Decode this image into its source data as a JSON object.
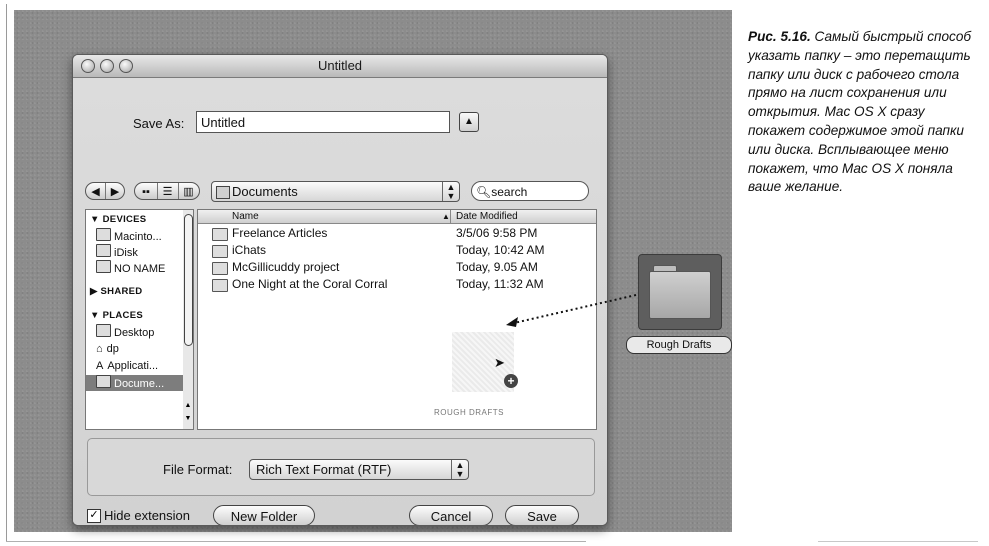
{
  "window": {
    "title": "Untitled"
  },
  "save_as": {
    "label": "Save As:",
    "value": "Untitled"
  },
  "toolbar": {
    "back_glyph": "◀",
    "forward_glyph": "▶",
    "location": "Documents",
    "search_placeholder": "search"
  },
  "sidebar": {
    "devices_heading": "▼ DEVICES",
    "devices": [
      "Macinto...",
      "iDisk",
      "NO NAME"
    ],
    "shared_heading": "▶ SHARED",
    "places_heading": "▼ PLACES",
    "places": [
      "Desktop",
      "dp",
      "Applicati...",
      "Docume..."
    ]
  },
  "file_list": {
    "col_name": "Name",
    "col_date": "Date Modified",
    "rows": [
      {
        "name": "Freelance Articles",
        "date": "3/5/06 9:58 PM"
      },
      {
        "name": "iChats",
        "date": "Today, 10:42 AM"
      },
      {
        "name": "McGillicuddy project",
        "date": "Today, 9.05 AM"
      },
      {
        "name": "One Night at the Coral Corral",
        "date": "Today, 11:32 AM"
      }
    ],
    "ghost_label": "ROUGH DRAFTS"
  },
  "file_format": {
    "label": "File Format:",
    "value": "Rich Text Format (RTF)"
  },
  "hide_extension": {
    "label": "Hide extension",
    "checked": true
  },
  "buttons": {
    "new_folder": "New Folder",
    "cancel": "Cancel",
    "save": "Save"
  },
  "dragged_folder": {
    "label": "Rough Drafts"
  },
  "caption": {
    "fig": "Рис. 5.16.",
    "text": "Самый быстрый способ указать папку – это перетащить папку или диск с рабочего стола прямо на лист сохранения или открытия. Mac OS X сразу покажет содержимое этой папки или диска. Всплывающее меню покажет, что Mac OS X поняла ваше желание."
  }
}
